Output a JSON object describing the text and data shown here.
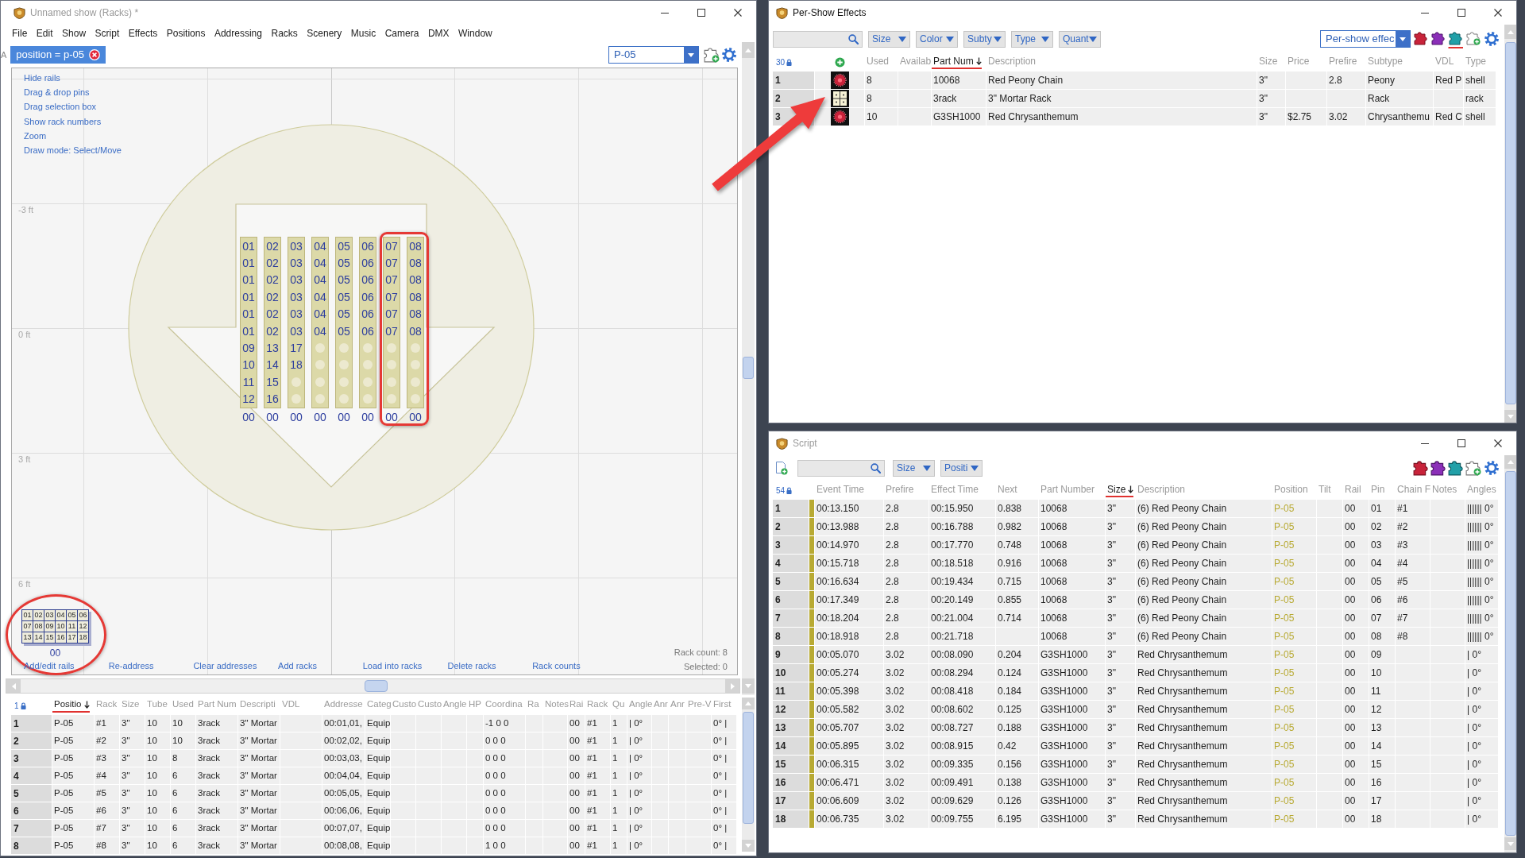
{
  "main_window": {
    "title": "Unnamed show (Racks) *",
    "active": false,
    "menu": [
      "File",
      "Edit",
      "Show",
      "Script",
      "Effects",
      "Positions",
      "Addressing",
      "Racks",
      "Scenery",
      "Music",
      "Camera",
      "DMX",
      "Window"
    ],
    "side_label": "A",
    "filter": "position = p-05",
    "position_select": "P-05",
    "canvas": {
      "tools": [
        "Hide rails",
        "Drag & drop pins",
        "Drag selection box",
        "Show rack numbers",
        "Zoom",
        "Draw mode: Select/Move"
      ],
      "grid_labels": [
        "-3 ft",
        "0 ft",
        "3 ft",
        "6 ft"
      ],
      "racks": [
        {
          "tubes": [
            {
              "kind": "loaded",
              "label": "01"
            },
            {
              "kind": "loaded",
              "label": "01"
            },
            {
              "kind": "loaded",
              "label": "01"
            },
            {
              "kind": "loaded",
              "label": "01"
            },
            {
              "kind": "loaded",
              "label": "01"
            },
            {
              "kind": "loaded",
              "label": "01"
            },
            {
              "kind": "loaded",
              "label": "09"
            },
            {
              "kind": "loaded",
              "label": "10"
            },
            {
              "kind": "loaded",
              "label": "11"
            },
            {
              "kind": "loaded",
              "label": "12"
            }
          ],
          "rail": "00",
          "highlighted": false
        },
        {
          "tubes": [
            {
              "kind": "loaded",
              "label": "02"
            },
            {
              "kind": "loaded",
              "label": "02"
            },
            {
              "kind": "loaded",
              "label": "02"
            },
            {
              "kind": "loaded",
              "label": "02"
            },
            {
              "kind": "loaded",
              "label": "02"
            },
            {
              "kind": "loaded",
              "label": "02"
            },
            {
              "kind": "loaded",
              "label": "13"
            },
            {
              "kind": "loaded",
              "label": "14"
            },
            {
              "kind": "loaded",
              "label": "15"
            },
            {
              "kind": "loaded",
              "label": "16"
            }
          ],
          "rail": "00",
          "highlighted": false
        },
        {
          "tubes": [
            {
              "kind": "loaded",
              "label": "03"
            },
            {
              "kind": "loaded",
              "label": "03"
            },
            {
              "kind": "loaded",
              "label": "03"
            },
            {
              "kind": "loaded",
              "label": "03"
            },
            {
              "kind": "loaded",
              "label": "03"
            },
            {
              "kind": "loaded",
              "label": "03"
            },
            {
              "kind": "loaded",
              "label": "17"
            },
            {
              "kind": "loaded",
              "label": "18"
            },
            {
              "kind": "empty"
            },
            {
              "kind": "empty"
            }
          ],
          "rail": "00",
          "highlighted": false
        },
        {
          "tubes": [
            {
              "kind": "loaded",
              "label": "04"
            },
            {
              "kind": "loaded",
              "label": "04"
            },
            {
              "kind": "loaded",
              "label": "04"
            },
            {
              "kind": "loaded",
              "label": "04"
            },
            {
              "kind": "loaded",
              "label": "04"
            },
            {
              "kind": "loaded",
              "label": "04"
            },
            {
              "kind": "empty"
            },
            {
              "kind": "empty"
            },
            {
              "kind": "empty"
            },
            {
              "kind": "empty"
            }
          ],
          "rail": "00",
          "highlighted": false
        },
        {
          "tubes": [
            {
              "kind": "loaded",
              "label": "05"
            },
            {
              "kind": "loaded",
              "label": "05"
            },
            {
              "kind": "loaded",
              "label": "05"
            },
            {
              "kind": "loaded",
              "label": "05"
            },
            {
              "kind": "loaded",
              "label": "05"
            },
            {
              "kind": "loaded",
              "label": "05"
            },
            {
              "kind": "empty"
            },
            {
              "kind": "empty"
            },
            {
              "kind": "empty"
            },
            {
              "kind": "empty"
            }
          ],
          "rail": "00",
          "highlighted": false
        },
        {
          "tubes": [
            {
              "kind": "loaded",
              "label": "06"
            },
            {
              "kind": "loaded",
              "label": "06"
            },
            {
              "kind": "loaded",
              "label": "06"
            },
            {
              "kind": "loaded",
              "label": "06"
            },
            {
              "kind": "loaded",
              "label": "06"
            },
            {
              "kind": "loaded",
              "label": "06"
            },
            {
              "kind": "empty"
            },
            {
              "kind": "empty"
            },
            {
              "kind": "empty"
            },
            {
              "kind": "empty"
            }
          ],
          "rail": "00",
          "highlighted": false
        },
        {
          "tubes": [
            {
              "kind": "loaded",
              "label": "07"
            },
            {
              "kind": "loaded",
              "label": "07"
            },
            {
              "kind": "loaded",
              "label": "07"
            },
            {
              "kind": "loaded",
              "label": "07"
            },
            {
              "kind": "loaded",
              "label": "07"
            },
            {
              "kind": "loaded",
              "label": "07"
            },
            {
              "kind": "empty"
            },
            {
              "kind": "empty"
            },
            {
              "kind": "empty"
            },
            {
              "kind": "empty"
            }
          ],
          "rail": "00",
          "highlighted": true
        },
        {
          "tubes": [
            {
              "kind": "loaded",
              "label": "08"
            },
            {
              "kind": "loaded",
              "label": "08"
            },
            {
              "kind": "loaded",
              "label": "08"
            },
            {
              "kind": "loaded",
              "label": "08"
            },
            {
              "kind": "loaded",
              "label": "08"
            },
            {
              "kind": "loaded",
              "label": "08"
            },
            {
              "kind": "empty"
            },
            {
              "kind": "empty"
            },
            {
              "kind": "empty"
            },
            {
              "kind": "empty"
            }
          ],
          "rail": "00",
          "highlighted": true
        }
      ],
      "legend": {
        "cells": [
          "01",
          "02",
          "03",
          "04",
          "05",
          "06",
          "07",
          "08",
          "09",
          "10",
          "11",
          "12",
          "13",
          "14",
          "15",
          "16",
          "17",
          "18"
        ],
        "rail": "00",
        "highlighted": true
      },
      "actions": [
        "Add/edit rails",
        "Re-address",
        "Clear addresses",
        "Add racks",
        "Load into racks",
        "Delete racks",
        "Rack counts"
      ],
      "rack_count": "Rack count: 8",
      "selected_count": "Selected: 0"
    },
    "table": {
      "count": "1",
      "columns": [
        {
          "label": "Positio",
          "sorted": true
        },
        {
          "label": "Rack",
          "sorted": false
        },
        {
          "label": "Size",
          "sorted": false
        },
        {
          "label": "Tube",
          "sorted": false
        },
        {
          "label": "Used",
          "sorted": false
        },
        {
          "label": "Part Num",
          "sorted": false
        },
        {
          "label": "Descripti",
          "sorted": false
        },
        {
          "label": "VDL",
          "sorted": false
        },
        {
          "label": "Addresse",
          "sorted": false
        },
        {
          "label": "Categ",
          "sorted": false
        },
        {
          "label": "Custo",
          "sorted": false
        },
        {
          "label": "Custo",
          "sorted": false
        },
        {
          "label": "Angle",
          "sorted": false
        },
        {
          "label": "HP",
          "sorted": false
        },
        {
          "label": "Coordina",
          "sorted": false
        },
        {
          "label": "Ra",
          "sorted": false
        },
        {
          "label": "Notes",
          "sorted": false
        },
        {
          "label": "Rai",
          "sorted": false
        },
        {
          "label": "Rack",
          "sorted": false
        },
        {
          "label": "Qu",
          "sorted": false
        },
        {
          "label": "Angle",
          "sorted": false
        },
        {
          "label": "Anr",
          "sorted": false
        },
        {
          "label": "Anr",
          "sorted": false
        },
        {
          "label": "Pre-V",
          "sorted": false
        },
        {
          "label": "First",
          "sorted": false
        }
      ],
      "rows": [
        {
          "number": "1",
          "cells": [
            "P-05",
            "#1",
            "3\"",
            "10",
            "10",
            "3rack",
            "3\" Mortar",
            null,
            "00:01,01,",
            "Equip",
            null,
            null,
            null,
            null,
            "-1 0 0",
            null,
            null,
            "00",
            "#1",
            "1",
            "| 0°",
            null,
            null,
            null,
            "0° |"
          ]
        },
        {
          "number": "2",
          "cells": [
            "P-05",
            "#2",
            "3\"",
            "10",
            "10",
            "3rack",
            "3\" Mortar",
            null,
            "00:02,02,",
            "Equip",
            null,
            null,
            null,
            null,
            "0 0 0",
            null,
            null,
            "00",
            "#1",
            "1",
            "| 0°",
            null,
            null,
            null,
            "0° |"
          ]
        },
        {
          "number": "3",
          "cells": [
            "P-05",
            "#3",
            "3\"",
            "10",
            "8",
            "3rack",
            "3\" Mortar",
            null,
            "00:03,03,",
            "Equip",
            null,
            null,
            null,
            null,
            "0 0 0",
            null,
            null,
            "00",
            "#1",
            "1",
            "| 0°",
            null,
            null,
            null,
            "0° |"
          ]
        },
        {
          "number": "4",
          "cells": [
            "P-05",
            "#4",
            "3\"",
            "10",
            "6",
            "3rack",
            "3\" Mortar",
            null,
            "00:04,04,",
            "Equip",
            null,
            null,
            null,
            null,
            "0 0 0",
            null,
            null,
            "00",
            "#1",
            "1",
            "| 0°",
            null,
            null,
            null,
            "0° |"
          ]
        },
        {
          "number": "5",
          "cells": [
            "P-05",
            "#5",
            "3\"",
            "10",
            "6",
            "3rack",
            "3\" Mortar",
            null,
            "00:05,05,",
            "Equip",
            null,
            null,
            null,
            null,
            "0 0 0",
            null,
            null,
            "00",
            "#1",
            "1",
            "| 0°",
            null,
            null,
            null,
            "0° |"
          ]
        },
        {
          "number": "6",
          "cells": [
            "P-05",
            "#6",
            "3\"",
            "10",
            "6",
            "3rack",
            "3\" Mortar",
            null,
            "00:06,06,",
            "Equip",
            null,
            null,
            null,
            null,
            "0 0 0",
            null,
            null,
            "00",
            "#1",
            "1",
            "| 0°",
            null,
            null,
            null,
            "0° |"
          ]
        },
        {
          "number": "7",
          "cells": [
            "P-05",
            "#7",
            "3\"",
            "10",
            "6",
            "3rack",
            "3\" Mortar",
            null,
            "00:07,07,",
            "Equip",
            null,
            null,
            null,
            null,
            "0 0 0",
            null,
            null,
            "00",
            "#1",
            "1",
            "| 0°",
            null,
            null,
            null,
            "0° |"
          ]
        },
        {
          "number": "8",
          "cells": [
            "P-05",
            "#8",
            "3\"",
            "10",
            "6",
            "3rack",
            "3\" Mortar",
            null,
            "00:08,08,",
            "Equip",
            null,
            null,
            null,
            null,
            "1 0 0",
            null,
            null,
            "00",
            "#1",
            "1",
            "| 0°",
            null,
            null,
            null,
            "0° |"
          ]
        }
      ]
    }
  },
  "effects_window": {
    "title": "Per-Show Effects",
    "active": true,
    "filters": [
      "Size",
      "Color",
      "Subty",
      "Type",
      "Quant"
    ],
    "view_select": "Per-show effec",
    "tools": [
      {
        "selected": false
      },
      {
        "selected": false
      },
      {
        "selected": true
      },
      {
        "selected": false
      }
    ],
    "table": {
      "count": "30",
      "columns": [
        {
          "label": "Used",
          "sorted": false
        },
        {
          "label": "Availab",
          "sorted": false
        },
        {
          "label": "Part Num",
          "sorted": true
        },
        {
          "label": "Description",
          "sorted": false
        },
        {
          "label": "Size",
          "sorted": false
        },
        {
          "label": "Price",
          "sorted": false
        },
        {
          "label": "Prefire",
          "sorted": false
        },
        {
          "label": "Subtype",
          "sorted": false
        },
        {
          "label": "VDL",
          "sorted": false
        },
        {
          "label": "Type",
          "sorted": false
        }
      ],
      "rows": [
        {
          "number": "1",
          "kind": "shell",
          "cells": [
            "8",
            null,
            "10068",
            "Red Peony Chain",
            "3\"",
            null,
            "2.8",
            "Peony",
            "Red P",
            "shell"
          ]
        },
        {
          "number": "2",
          "kind": "rack",
          "cells": [
            "8",
            null,
            "3rack",
            "3\" Mortar Rack",
            "3\"",
            null,
            null,
            "Rack",
            null,
            "rack"
          ]
        },
        {
          "number": "3",
          "kind": "shell",
          "cells": [
            "10",
            null,
            "G3SH1000",
            "Red Chrysanthemum",
            "3\"",
            "$2.75",
            "3.02",
            "Chrysanthemu",
            "Red C",
            "shell"
          ]
        }
      ]
    }
  },
  "script_window": {
    "title": "Script",
    "active": false,
    "filters": [
      "Size",
      "Positi"
    ],
    "table": {
      "count": "54",
      "columns": [
        {
          "label": "Event Time",
          "sorted": false
        },
        {
          "label": "Prefire",
          "sorted": false
        },
        {
          "label": "Effect Time",
          "sorted": false
        },
        {
          "label": "Next",
          "sorted": false
        },
        {
          "label": "Part Number",
          "sorted": false
        },
        {
          "label": "Size",
          "sorted": true
        },
        {
          "label": "Description",
          "sorted": false
        },
        {
          "label": "Position",
          "sorted": false
        },
        {
          "label": "Tilt",
          "sorted": false
        },
        {
          "label": "Rail",
          "sorted": false
        },
        {
          "label": "Pin",
          "sorted": false
        },
        {
          "label": "Chain F",
          "sorted": false
        },
        {
          "label": "Notes",
          "sorted": false
        },
        {
          "label": "Angles",
          "sorted": false
        }
      ],
      "rows": [
        {
          "number": "1",
          "color": "#b8aa33",
          "cells": [
            "00:13.150",
            "2.8",
            "00:15.950",
            "0.838",
            "10068",
            "3\"",
            "(6) Red Peony Chain",
            "P-05",
            null,
            "00",
            "01",
            "#1",
            null,
            "|||||| 0°"
          ]
        },
        {
          "number": "2",
          "color": "#b8aa33",
          "cells": [
            "00:13.988",
            "2.8",
            "00:16.788",
            "0.982",
            "10068",
            "3\"",
            "(6) Red Peony Chain",
            "P-05",
            null,
            "00",
            "02",
            "#2",
            null,
            "|||||| 0°"
          ]
        },
        {
          "number": "3",
          "color": "#b8aa33",
          "cells": [
            "00:14.970",
            "2.8",
            "00:17.770",
            "0.748",
            "10068",
            "3\"",
            "(6) Red Peony Chain",
            "P-05",
            null,
            "00",
            "03",
            "#3",
            null,
            "|||||| 0°"
          ]
        },
        {
          "number": "4",
          "color": "#b8aa33",
          "cells": [
            "00:15.718",
            "2.8",
            "00:18.518",
            "0.916",
            "10068",
            "3\"",
            "(6) Red Peony Chain",
            "P-05",
            null,
            "00",
            "04",
            "#4",
            null,
            "|||||| 0°"
          ]
        },
        {
          "number": "5",
          "color": "#b8aa33",
          "cells": [
            "00:16.634",
            "2.8",
            "00:19.434",
            "0.715",
            "10068",
            "3\"",
            "(6) Red Peony Chain",
            "P-05",
            null,
            "00",
            "05",
            "#5",
            null,
            "|||||| 0°"
          ]
        },
        {
          "number": "6",
          "color": "#b8aa33",
          "cells": [
            "00:17.349",
            "2.8",
            "00:20.149",
            "0.855",
            "10068",
            "3\"",
            "(6) Red Peony Chain",
            "P-05",
            null,
            "00",
            "06",
            "#6",
            null,
            "|||||| 0°"
          ]
        },
        {
          "number": "7",
          "color": "#b8aa33",
          "cells": [
            "00:18.204",
            "2.8",
            "00:21.004",
            "0.714",
            "10068",
            "3\"",
            "(6) Red Peony Chain",
            "P-05",
            null,
            "00",
            "07",
            "#7",
            null,
            "|||||| 0°"
          ]
        },
        {
          "number": "8",
          "color": "#b8aa33",
          "cells": [
            "00:18.918",
            "2.8",
            "00:21.718",
            null,
            "10068",
            "3\"",
            "(6) Red Peony Chain",
            "P-05",
            null,
            "00",
            "08",
            "#8",
            null,
            "|||||| 0°"
          ]
        },
        {
          "number": "9",
          "color": "#b8aa33",
          "cells": [
            "00:05.070",
            "3.02",
            "00:08.090",
            "0.204",
            "G3SH1000",
            "3\"",
            "Red Chrysanthemum",
            "P-05",
            null,
            "00",
            "09",
            null,
            null,
            "| 0°"
          ]
        },
        {
          "number": "10",
          "color": "#b8aa33",
          "cells": [
            "00:05.274",
            "3.02",
            "00:08.294",
            "0.124",
            "G3SH1000",
            "3\"",
            "Red Chrysanthemum",
            "P-05",
            null,
            "00",
            "10",
            null,
            null,
            "| 0°"
          ]
        },
        {
          "number": "11",
          "color": "#b8aa33",
          "cells": [
            "00:05.398",
            "3.02",
            "00:08.418",
            "0.184",
            "G3SH1000",
            "3\"",
            "Red Chrysanthemum",
            "P-05",
            null,
            "00",
            "11",
            null,
            null,
            "| 0°"
          ]
        },
        {
          "number": "12",
          "color": "#b8aa33",
          "cells": [
            "00:05.582",
            "3.02",
            "00:08.602",
            "0.125",
            "G3SH1000",
            "3\"",
            "Red Chrysanthemum",
            "P-05",
            null,
            "00",
            "12",
            null,
            null,
            "| 0°"
          ]
        },
        {
          "number": "13",
          "color": "#b8aa33",
          "cells": [
            "00:05.707",
            "3.02",
            "00:08.727",
            "0.188",
            "G3SH1000",
            "3\"",
            "Red Chrysanthemum",
            "P-05",
            null,
            "00",
            "13",
            null,
            null,
            "| 0°"
          ]
        },
        {
          "number": "14",
          "color": "#b8aa33",
          "cells": [
            "00:05.895",
            "3.02",
            "00:08.915",
            "0.42",
            "G3SH1000",
            "3\"",
            "Red Chrysanthemum",
            "P-05",
            null,
            "00",
            "14",
            null,
            null,
            "| 0°"
          ]
        },
        {
          "number": "15",
          "color": "#b8aa33",
          "cells": [
            "00:06.315",
            "3.02",
            "00:09.335",
            "0.156",
            "G3SH1000",
            "3\"",
            "Red Chrysanthemum",
            "P-05",
            null,
            "00",
            "15",
            null,
            null,
            "| 0°"
          ]
        },
        {
          "number": "16",
          "color": "#b8aa33",
          "cells": [
            "00:06.471",
            "3.02",
            "00:09.491",
            "0.138",
            "G3SH1000",
            "3\"",
            "Red Chrysanthemum",
            "P-05",
            null,
            "00",
            "16",
            null,
            null,
            "| 0°"
          ]
        },
        {
          "number": "17",
          "color": "#b8aa33",
          "cells": [
            "00:06.609",
            "3.02",
            "00:09.629",
            "0.126",
            "G3SH1000",
            "3\"",
            "Red Chrysanthemum",
            "P-05",
            null,
            "00",
            "17",
            null,
            null,
            "| 0°"
          ]
        },
        {
          "number": "18",
          "color": "#b8aa33",
          "cells": [
            "00:06.735",
            "3.02",
            "00:09.755",
            "6.195",
            "G3SH1000",
            "3\"",
            "Red Chrysanthemum",
            "P-05",
            null,
            "00",
            "18",
            null,
            null,
            "| 0°"
          ]
        }
      ]
    }
  }
}
